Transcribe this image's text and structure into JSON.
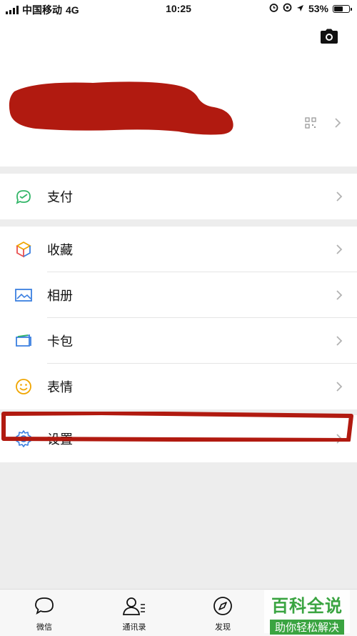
{
  "status_bar": {
    "carrier": "中国移动",
    "network": "4G",
    "time": "10:25",
    "battery": "53%"
  },
  "profile": {
    "camera_icon": "camera-icon",
    "qr_icon": "qr-code-icon"
  },
  "menu": {
    "pay": {
      "label": "支付",
      "icon": "wechat-pay-icon"
    },
    "favorites": {
      "label": "收藏",
      "icon": "cube-icon"
    },
    "album": {
      "label": "相册",
      "icon": "photo-icon"
    },
    "cards": {
      "label": "卡包",
      "icon": "wallet-icon"
    },
    "stickers": {
      "label": "表情",
      "icon": "smiley-icon"
    },
    "settings": {
      "label": "设置",
      "icon": "gear-icon"
    }
  },
  "tabbar": {
    "chats": "微信",
    "contacts": "通讯录",
    "discover": "发现"
  },
  "watermark": {
    "title": "百科全说",
    "subtitle": "助你轻松解决"
  },
  "colors": {
    "annotation_red": "#b11a10",
    "watermark_green": "#3aa441"
  }
}
